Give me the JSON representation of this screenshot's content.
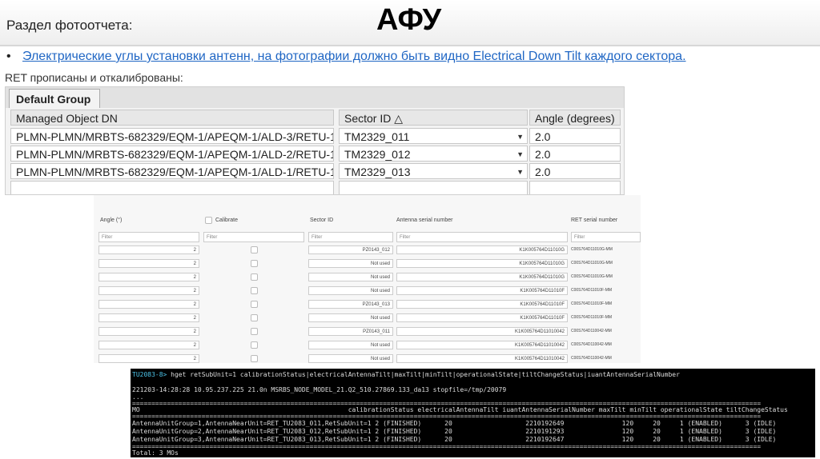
{
  "header": {
    "section_label": "Раздел фотоотчета:",
    "title": "АФУ"
  },
  "bullet": {
    "symbol": "•",
    "text": "Электрические углы установки антенн, на фотографии должно быть видно Electrical Down Tilt каждого сектора."
  },
  "ret_caption": "RET прописаны и откалиброваны:",
  "grid_top": {
    "tab": "Default Group",
    "headers": {
      "mo": "Managed Object DN",
      "sector": "Sector ID △",
      "angle": "Angle (degrees)"
    },
    "rows": [
      {
        "mo": "PLMN-PLMN/MRBTS-682329/EQM-1/APEQM-1/ALD-3/RETU-1",
        "sector": "TM2329_011",
        "angle": "2.0"
      },
      {
        "mo": "PLMN-PLMN/MRBTS-682329/EQM-1/APEQM-1/ALD-2/RETU-1",
        "sector": "TM2329_012",
        "angle": "2.0"
      },
      {
        "mo": "PLMN-PLMN/MRBTS-682329/EQM-1/APEQM-1/ALD-1/RETU-1",
        "sector": "TM2329_013",
        "angle": "2.0"
      }
    ]
  },
  "grid_mid": {
    "headers": {
      "angle": "Angle (°)",
      "calibrate": "Calibrate",
      "sector": "Sector ID",
      "antenna": "Antenna serial number",
      "ret": "RET serial number"
    },
    "filter_placeholder": "Filter",
    "rows": [
      {
        "angle": "2",
        "sector": "PZ0143_012",
        "antenna": "K1K005764D11010G",
        "ret": "C00S764D11010G-MM"
      },
      {
        "angle": "2",
        "sector": "Not used",
        "antenna": "K1K005764D11010G",
        "ret": "C00S764D11010G-MM"
      },
      {
        "angle": "2",
        "sector": "Not used",
        "antenna": "K1K005764D11010G",
        "ret": "C00S764D11010G-MM"
      },
      {
        "angle": "2",
        "sector": "Not used",
        "antenna": "K1K005764D11010F",
        "ret": "C00S764D11010F-MM"
      },
      {
        "angle": "2",
        "sector": "PZ0143_013",
        "antenna": "K1K005764D11010F",
        "ret": "C00S764D11010F-MM"
      },
      {
        "angle": "2",
        "sector": "Not used",
        "antenna": "K1K005764D11010F",
        "ret": "C00S764D11010F-MM"
      },
      {
        "angle": "2",
        "sector": "PZ0143_011",
        "antenna": "K1K005764D11010042",
        "ret": "C00S764D110042-MM"
      },
      {
        "angle": "2",
        "sector": "Not used",
        "antenna": "K1K005764D11010042",
        "ret": "C00S764D110042-MM"
      },
      {
        "angle": "2",
        "sector": "Not used",
        "antenna": "K1K005764D11010042",
        "ret": "C00S764D110042-MM"
      }
    ]
  },
  "terminal": {
    "prompt": "TU2083-8>",
    "command": " hget retSubUnit=1 calibrationStatus|electricalAntennaTilt|maxTilt|minTilt|operationalState|tiltChangeStatus|iuantAntennaSerialNumber",
    "info": "221203-14:28:28 10.95.237.225 21.0n MSRBS_NODE_MODEL_21.Q2_510.27869.133_da13 stopfile=/tmp/20079",
    "dots": "...",
    "sep": "===================================================================================================================================================================",
    "header": "MO                                                      calibrationStatus electricalAntennaTilt iuantAntennaSerialNumber maxTilt minTilt operationalState tiltChangeStatus",
    "rows": [
      "AntennaUnitGroup=1,AntennaNearUnit=RET_TU2083_011,RetSubUnit=1 2 (FINISHED)      20                   2210192649               120     20     1 (ENABLED)      3 (IDLE)",
      "AntennaUnitGroup=2,AntennaNearUnit=RET_TU2083_012,RetSubUnit=1 2 (FINISHED)      20                   2210191293               120     20     1 (ENABLED)      3 (IDLE)",
      "AntennaUnitGroup=3,AntennaNearUnit=RET_TU2083_013,RetSubUnit=1 2 (FINISHED)      20                   2210192647               120     20     1 (ENABLED)      3 (IDLE)"
    ],
    "total": "Total: 3 MOs"
  }
}
